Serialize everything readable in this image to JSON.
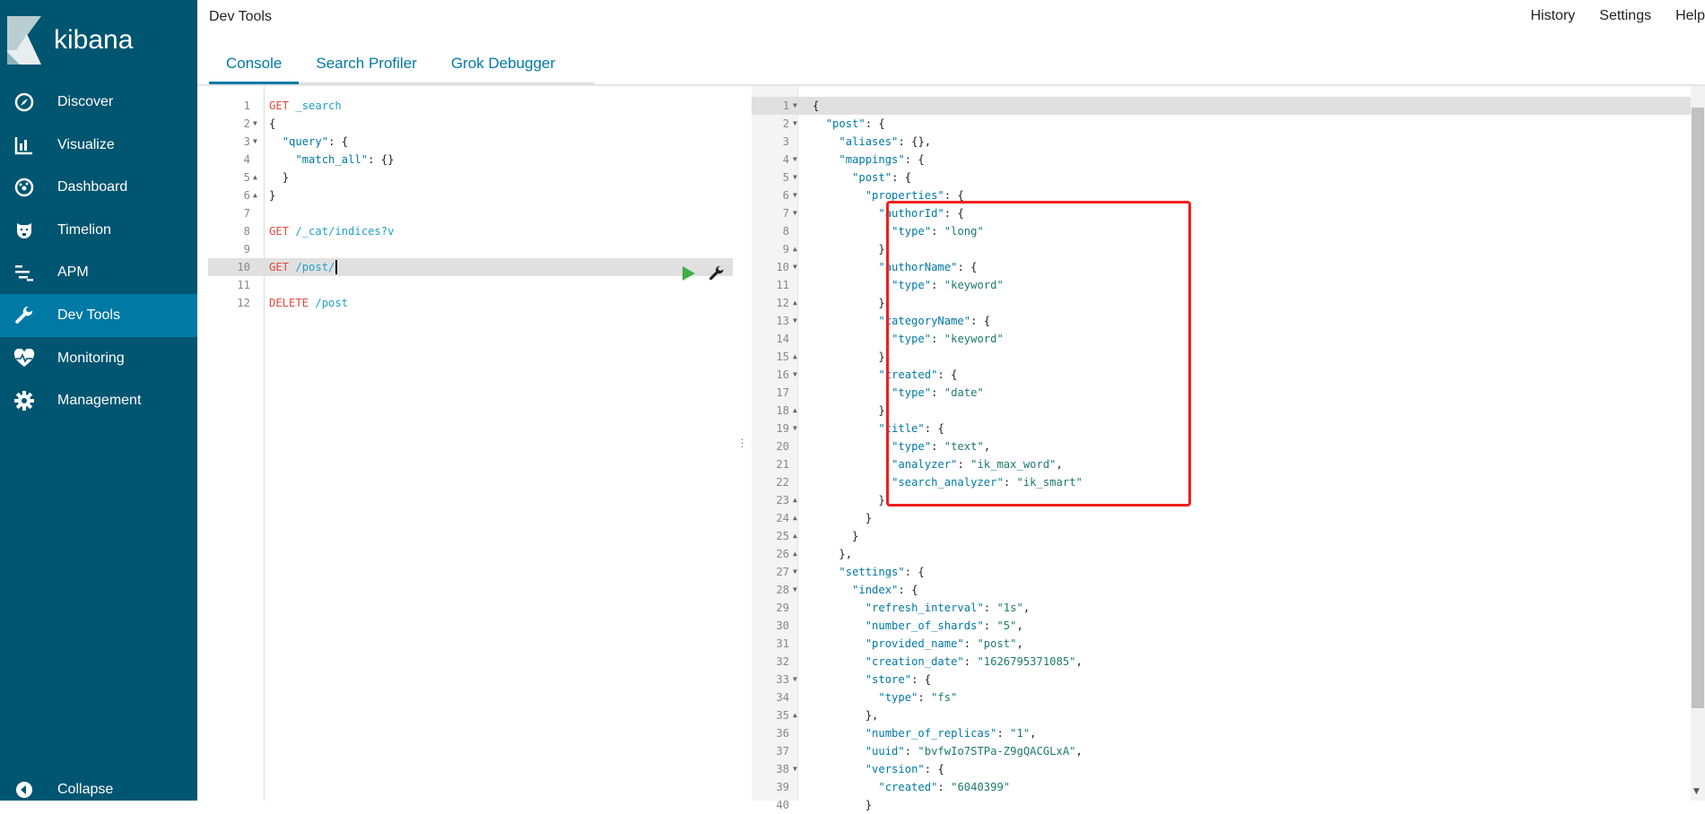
{
  "app": {
    "logo_text": "kibana",
    "title": "Dev Tools"
  },
  "sidebar": {
    "items": [
      {
        "label": "Discover",
        "icon": "compass-icon"
      },
      {
        "label": "Visualize",
        "icon": "bar-chart-icon"
      },
      {
        "label": "Dashboard",
        "icon": "dashboard-icon"
      },
      {
        "label": "Timelion",
        "icon": "timelion-icon"
      },
      {
        "label": "APM",
        "icon": "apm-icon"
      },
      {
        "label": "Dev Tools",
        "icon": "wrench-icon",
        "active": true
      },
      {
        "label": "Monitoring",
        "icon": "heartbeat-icon"
      },
      {
        "label": "Management",
        "icon": "gear-icon"
      }
    ],
    "collapse": "Collapse"
  },
  "tabs": [
    {
      "label": "Console",
      "active": true
    },
    {
      "label": "Search Profiler"
    },
    {
      "label": "Grok Debugger"
    }
  ],
  "top_links": [
    "History",
    "Settings",
    "Help"
  ],
  "colors": {
    "sidebar": "#005571",
    "active": "#0079a5",
    "highlight_box": "#ee1f1f"
  },
  "request_editor": {
    "active_line": 10,
    "lines": [
      "GET _search",
      "{",
      "  \"query\": {",
      "    \"match_all\": {}",
      "  }",
      "}",
      "",
      "GET /_cat/indices?v",
      "",
      "GET /post/",
      "",
      "DELETE /post"
    ],
    "folds": [
      "",
      "down",
      "down",
      "",
      "up",
      "up",
      "",
      "",
      "",
      "",
      "",
      ""
    ]
  },
  "response_editor": {
    "active_line": 1,
    "lines": [
      "{",
      "  \"post\": {",
      "    \"aliases\": {},",
      "    \"mappings\": {",
      "      \"post\": {",
      "        \"properties\": {",
      "          \"authorId\": {",
      "            \"type\": \"long\"",
      "          },",
      "          \"authorName\": {",
      "            \"type\": \"keyword\"",
      "          },",
      "          \"categoryName\": {",
      "            \"type\": \"keyword\"",
      "          },",
      "          \"created\": {",
      "            \"type\": \"date\"",
      "          },",
      "          \"title\": {",
      "            \"type\": \"text\",",
      "            \"analyzer\": \"ik_max_word\",",
      "            \"search_analyzer\": \"ik_smart\"",
      "          }",
      "        }",
      "      }",
      "    },",
      "    \"settings\": {",
      "      \"index\": {",
      "        \"refresh_interval\": \"1s\",",
      "        \"number_of_shards\": \"5\",",
      "        \"provided_name\": \"post\",",
      "        \"creation_date\": \"1626795371085\",",
      "        \"store\": {",
      "          \"type\": \"fs\"",
      "        },",
      "        \"number_of_replicas\": \"1\",",
      "        \"uuid\": \"bvfwIo7STPa-Z9gQACGLxA\",",
      "        \"version\": {",
      "          \"created\": \"6040399\"",
      "        }"
    ],
    "folds": [
      "down",
      "down",
      "",
      "down",
      "down",
      "down",
      "down",
      "",
      "up",
      "down",
      "",
      "up",
      "down",
      "",
      "up",
      "down",
      "",
      "up",
      "down",
      "",
      "",
      "",
      "up",
      "up",
      "up",
      "up",
      "down",
      "down",
      "",
      "",
      "",
      "",
      "down",
      "",
      "up",
      "",
      "",
      "down",
      "",
      ""
    ]
  }
}
